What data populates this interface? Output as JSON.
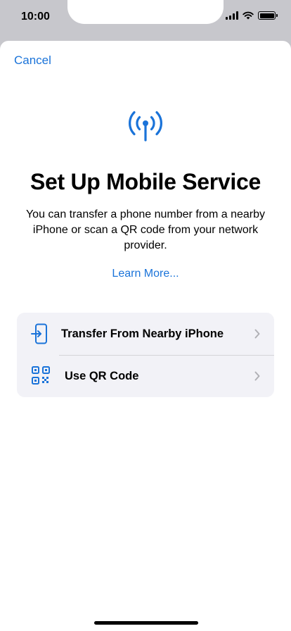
{
  "status_bar": {
    "time": "10:00",
    "battery_level": 1.0
  },
  "sheet": {
    "cancel_label": "Cancel",
    "hero_icon": "antenna-icon",
    "title": "Set Up Mobile Service",
    "description": "You can transfer a phone number from a nearby iPhone or scan a QR code from your network provider.",
    "learn_more_label": "Learn More..."
  },
  "options": [
    {
      "label": "Transfer From Nearby iPhone",
      "icon": "transfer-phone-icon"
    },
    {
      "label": "Use QR Code",
      "icon": "qr-code-icon"
    }
  ],
  "colors": {
    "accent": "#1a73d9",
    "sheet_background": "#ffffff",
    "option_background": "#f2f2f7",
    "chrome_background": "#c7c7cc"
  }
}
